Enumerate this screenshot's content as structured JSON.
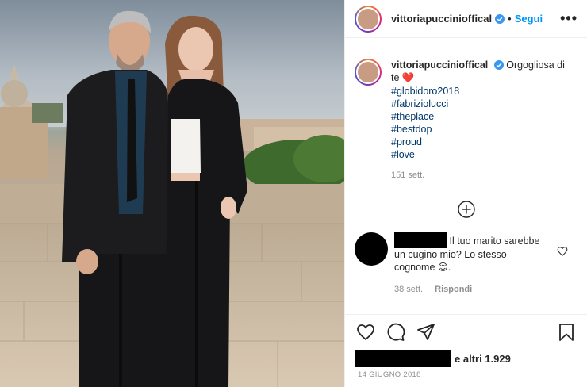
{
  "post": {
    "username": "vittoriapuccinioffical",
    "follow_label": "Segui",
    "more_label": "•••",
    "caption_text": "Orgogliosa di te",
    "caption_emoji": "❤️",
    "hashtags": [
      "#globidoro2018",
      "#fabriziolucci",
      "#theplace",
      "#bestdop",
      "#proud",
      "#love"
    ],
    "caption_age": "151 sett.",
    "comment": {
      "text": "Il tuo marito sarebbe un cugino mio? Lo stesso cognome 😌.",
      "age": "38 sett.",
      "reply_label": "Rispondi"
    },
    "likes_suffix": "e altri 1.929",
    "date": "14 GIUGNO 2018"
  },
  "colors": {
    "link_blue": "#0095f6",
    "hashtag_blue": "#00376b",
    "verified_blue": "#3897f0",
    "heart_red": "#ed4956"
  },
  "icons": [
    "verified-badge-icon",
    "more-options-icon",
    "plus-circle-icon",
    "heart-icon",
    "comment-icon",
    "share-icon",
    "bookmark-icon"
  ]
}
